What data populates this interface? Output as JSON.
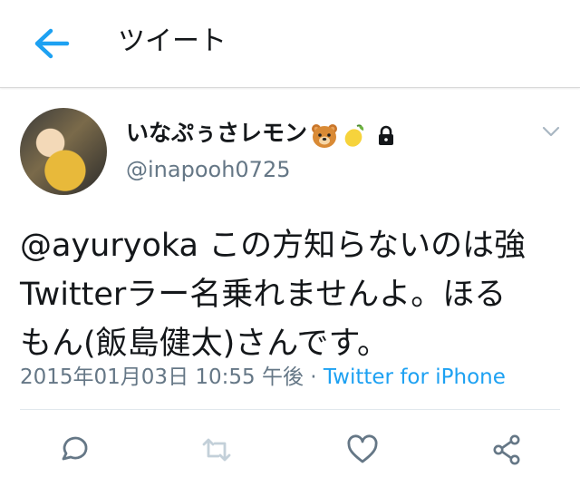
{
  "header": {
    "title": "ツイート",
    "back_icon": "arrow-left-icon",
    "accent": "#1da1f2"
  },
  "user": {
    "name": "いなぷぅさレモン",
    "handle": "@inapooh0725",
    "badges": [
      "bear-emoji-icon",
      "lemon-emoji-icon",
      "lock-icon"
    ]
  },
  "tweet": {
    "mention": "@ayuryoka",
    "line1_rest": " この方知らないのは強",
    "line2": "Twitterラー名乗れませんよ。ほる",
    "line3": "もん(飯島健太)さんです。",
    "timestamp": "2015年01月03日 10:55 午後",
    "separator": " · ",
    "source": "Twitter for iPhone"
  },
  "actions": [
    {
      "name": "reply",
      "icon": "reply-icon"
    },
    {
      "name": "retweet",
      "icon": "retweet-icon"
    },
    {
      "name": "like",
      "icon": "heart-icon"
    },
    {
      "name": "share",
      "icon": "share-icon"
    }
  ],
  "colors": {
    "text": "#14171a",
    "secondary": "#657786",
    "link": "#1da1f2",
    "retweet_disabled": "#c3d0d9"
  }
}
